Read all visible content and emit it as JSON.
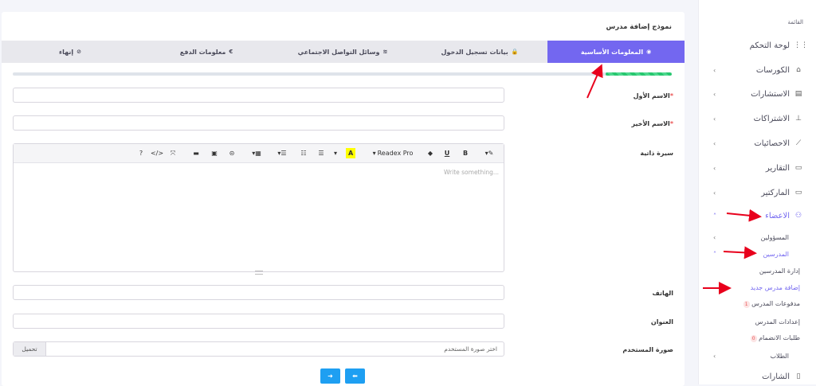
{
  "sidebar": {
    "menu_title": "القائمة",
    "items": [
      {
        "label": "لوحة التحكم",
        "icon": "grid-icon",
        "glyph": "⋮⋮"
      },
      {
        "label": "الكورسات",
        "icon": "basket-icon",
        "glyph": "⌂",
        "chev": "‹"
      },
      {
        "label": "الاستشارات",
        "icon": "file-icon",
        "glyph": "▤",
        "chev": "‹"
      },
      {
        "label": "الاشتراكات",
        "icon": "sitemap-icon",
        "glyph": "⊥",
        "chev": "‹"
      },
      {
        "label": "الاحصائيات",
        "icon": "trend-icon",
        "glyph": "⟋",
        "chev": "‹"
      },
      {
        "label": "التقارير",
        "icon": "archive-icon",
        "glyph": "▭",
        "chev": "‹"
      },
      {
        "label": "الماركتير",
        "icon": "archive-icon",
        "glyph": "▭",
        "chev": "‹"
      },
      {
        "label": "الاعضاء",
        "icon": "users-icon",
        "glyph": "⚇",
        "chev": "˄"
      }
    ],
    "members_sub": [
      {
        "label": "المسؤولين",
        "chev": "‹"
      },
      {
        "label": "المدرسين",
        "chev": "˄"
      }
    ],
    "teacher_sub": [
      {
        "label": "إدارة المدرسين"
      },
      {
        "label": "إضافة مدرس جديد"
      },
      {
        "label": "مدفوعات المدرس",
        "badge": "1"
      },
      {
        "label": "إعدادات المدرس"
      },
      {
        "label": "طلبات الانضمام",
        "badge": "0"
      }
    ],
    "students": {
      "label": "الطلاب",
      "chev": "‹"
    },
    "badges": {
      "label": "الشارات",
      "icon": "badge-icon",
      "glyph": "▯"
    }
  },
  "form": {
    "title": "نموذج إضافة مدرس",
    "tabs": [
      {
        "label": "المعلومات الأساسية",
        "glyph": "◉"
      },
      {
        "label": "بيانات تسجيل الدخول",
        "glyph": "🔒"
      },
      {
        "label": "وسائل التواصل الاجتماعي",
        "glyph": "≋"
      },
      {
        "label": "معلومات الدفع",
        "glyph": "€"
      },
      {
        "label": "إنهاء",
        "glyph": "⊘"
      }
    ],
    "progress": 0.1,
    "first_name_label": "الاسم الأول",
    "last_name_label": "الاسم الأخير",
    "required_mark": "*",
    "bio_label": "سيرة ذاتية",
    "editor": {
      "placeholder": "Write something...",
      "font": "Readex Pro",
      "tools": [
        "?",
        "</>",
        "⤧",
        "▬",
        "▣",
        "⊝",
        "▾▦",
        "▾☰",
        "☷",
        "☰",
        "▾",
        "A",
        "▾",
        "◆",
        "U",
        "B",
        "▾✎"
      ]
    },
    "phone_label": "الهاتف",
    "address_label": "العنوان",
    "photo_label": "صورة المستخدم",
    "photo_placeholder": "اختر صورة المستخدم",
    "upload_label": "تحميل",
    "next_glyph": "➜",
    "prev_glyph": "⬅"
  },
  "colors": {
    "accent": "#7367f0",
    "progress": "#28c76f",
    "button": "#1e9ff2",
    "annotation": "#e8001c"
  }
}
